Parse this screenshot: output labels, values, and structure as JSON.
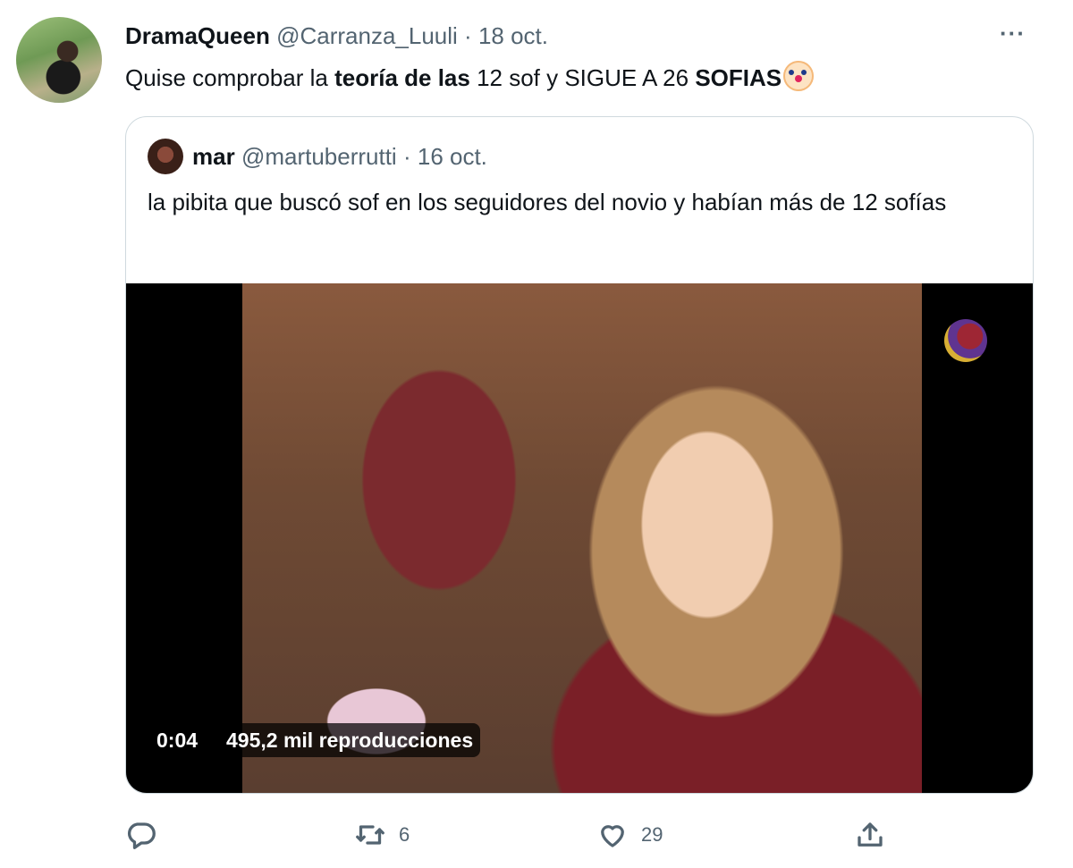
{
  "author": {
    "display_name": "DramaQueen",
    "handle": "@Carranza_Luuli",
    "separator": "·",
    "date": "18 oct."
  },
  "tweet": {
    "text_part1": "Quise comprobar la ",
    "text_bold1": "teoría de las",
    "text_part2": " 12 sof y SIGUE A 26 ",
    "text_bold2": "SOFIAS",
    "emoji": "clown-face-emoji"
  },
  "more_label": "···",
  "quoted": {
    "display_name": "mar",
    "handle": "@martuberrutti",
    "separator": "·",
    "date": "16 oct.",
    "text": "la pibita que buscó sof en los seguidores del novio y habían más de 12 sofías",
    "video": {
      "time": "0:04",
      "views": "495,2 mil reproducciones"
    }
  },
  "actions": {
    "reply_icon": "reply-icon",
    "retweet_icon": "retweet-icon",
    "retweet_count": "6",
    "like_icon": "heart-icon",
    "like_count": "29",
    "share_icon": "share-icon"
  },
  "colors": {
    "text": "#0f1419",
    "muted": "#536471",
    "border": "#cfd9de"
  }
}
